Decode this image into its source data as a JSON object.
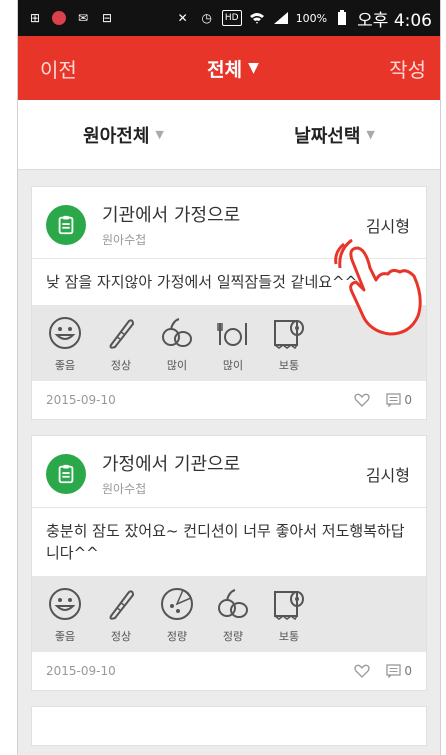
{
  "statusbar": {
    "time": "오후 4:06",
    "battery": "100%",
    "icons": [
      "plus-icon",
      "app-icon",
      "mail-icon",
      "download-icon",
      "mute-icon",
      "alarm-icon",
      "hd-voice-icon",
      "wifi-icon",
      "signal-icon",
      "battery-icon"
    ]
  },
  "appbar": {
    "prev_label": "이전",
    "title": "전체",
    "write_label": "작성"
  },
  "filters": {
    "child_label": "원아전체",
    "date_label": "날짜선택"
  },
  "posts": [
    {
      "title": "기관에서 가정으로",
      "subtitle": "원아수첩",
      "author": "김시형",
      "body": "낮 잠을 자지않아 가정에서 일찍잠들것 같네요^^",
      "icons": [
        {
          "name": "smile-icon",
          "label": "좋음"
        },
        {
          "name": "thermometer-icon",
          "label": "정상"
        },
        {
          "name": "poop-icon",
          "label": "많이"
        },
        {
          "name": "meal-icon",
          "label": "많이"
        },
        {
          "name": "toilet-paper-icon",
          "label": "보통"
        }
      ],
      "date": "2015-09-10",
      "comments": "0"
    },
    {
      "title": "가정에서 기관으로",
      "subtitle": "원아수첩",
      "author": "김시형",
      "body": "충분히 잠도 잤어요~ 컨디션이 너무 좋아서 저도행복하답니다^^",
      "icons": [
        {
          "name": "smile-icon",
          "label": "좋음"
        },
        {
          "name": "thermometer-icon",
          "label": "정상"
        },
        {
          "name": "pizza-icon",
          "label": "정량"
        },
        {
          "name": "poop-icon",
          "label": "정량"
        },
        {
          "name": "toilet-paper-icon",
          "label": "보통"
        }
      ],
      "date": "2015-09-10",
      "comments": "0"
    }
  ],
  "colors": {
    "appbar": "#e8352a",
    "avatar": "#2aa84a",
    "hand": "#e8352a"
  }
}
